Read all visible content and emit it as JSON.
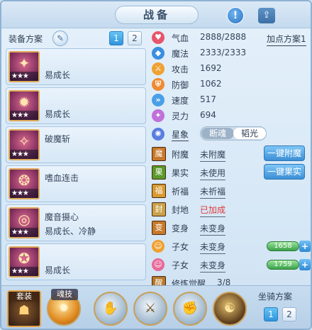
{
  "header": {
    "title": "战备",
    "info_icon": "!",
    "share_icon": "share-icon"
  },
  "scheme": {
    "label": "装备方案",
    "tabs": [
      "1",
      "2"
    ],
    "active": 0
  },
  "equipment": [
    {
      "name": "易成长",
      "sub": "",
      "stars": "★★★",
      "glyph": "✦",
      "icon": "ice-sword-icon"
    },
    {
      "name": "易成长",
      "sub": "",
      "stars": "★★★",
      "glyph": "✹",
      "icon": "armor-icon"
    },
    {
      "name": "破魔斩",
      "sub": "",
      "stars": "★★★",
      "glyph": "✧",
      "icon": "helmet-icon"
    },
    {
      "name": "嗜血连击",
      "sub": "",
      "stars": "★★★",
      "glyph": "❂",
      "icon": "necklace-icon"
    },
    {
      "name": "魔音摄心",
      "sub": "易成长、冷静",
      "stars": "★★★",
      "glyph": "◎",
      "icon": "belt-icon"
    },
    {
      "name": "易成长",
      "sub": "",
      "stars": "★★★",
      "glyph": "✪",
      "icon": "boots-icon"
    }
  ],
  "stats": [
    {
      "label": "气血",
      "value": "2888/2888",
      "icon": "hp-heart-icon",
      "color": "#e8556a",
      "glyph": "♥"
    },
    {
      "label": "魔法",
      "value": "2333/2333",
      "icon": "mp-diamond-icon",
      "color": "#3a8fe0",
      "glyph": "◆"
    },
    {
      "label": "攻击",
      "value": "1692",
      "icon": "attack-icon",
      "color": "#f0a030",
      "glyph": "⚔"
    },
    {
      "label": "防御",
      "value": "1062",
      "icon": "defense-icon",
      "color": "#f08a30",
      "glyph": "⛨"
    },
    {
      "label": "速度",
      "value": "517",
      "icon": "speed-icon",
      "color": "#4aa0e8",
      "glyph": "»"
    },
    {
      "label": "灵力",
      "value": "694",
      "icon": "spirit-icon",
      "color": "#c070d8",
      "glyph": "✦"
    }
  ],
  "plan_button": "加点方案1",
  "xingxiang": {
    "label": "星象",
    "options": [
      "断魂",
      "韬光"
    ],
    "active": 1,
    "icon": "star-sign-icon"
  },
  "features": [
    {
      "label": "附魔",
      "value": "未附魔",
      "icon": "enchant-icon",
      "action": "一键附魔",
      "red": false
    },
    {
      "label": "果实",
      "value": "未使用",
      "icon": "fruit-icon",
      "action": "一键果实",
      "red": false
    },
    {
      "label": "祈福",
      "value": "未祈福",
      "icon": "blessing-icon",
      "action": "",
      "red": false
    },
    {
      "label": "封地",
      "value": "已加成",
      "icon": "fief-icon",
      "action": "",
      "red": true
    },
    {
      "label": "变身",
      "value": "未变身",
      "icon": "transform-icon",
      "action": "",
      "red": false
    }
  ],
  "children": [
    {
      "label": "子女",
      "value": "未变身",
      "icon": "child-boy-icon",
      "bar": "1658",
      "bar_pct": 100
    },
    {
      "label": "子女",
      "value": "未变身",
      "icon": "child-girl-icon",
      "bar": "1759",
      "bar_pct": 100
    }
  ],
  "awakening": {
    "label": "修炼觉醒",
    "value": "3/8",
    "icon": "awakening-icon"
  },
  "bottom": {
    "suit_tag": "套装",
    "soul_tag": "魂技",
    "skills": [
      "flame-skill-icon",
      "palm-skill-icon",
      "sword-skill-icon",
      "fist-skill-icon",
      "shadow-skill-icon"
    ],
    "mount_label": "坐骑方案",
    "mount_tabs": [
      "1",
      "2"
    ],
    "mount_active": 0
  }
}
